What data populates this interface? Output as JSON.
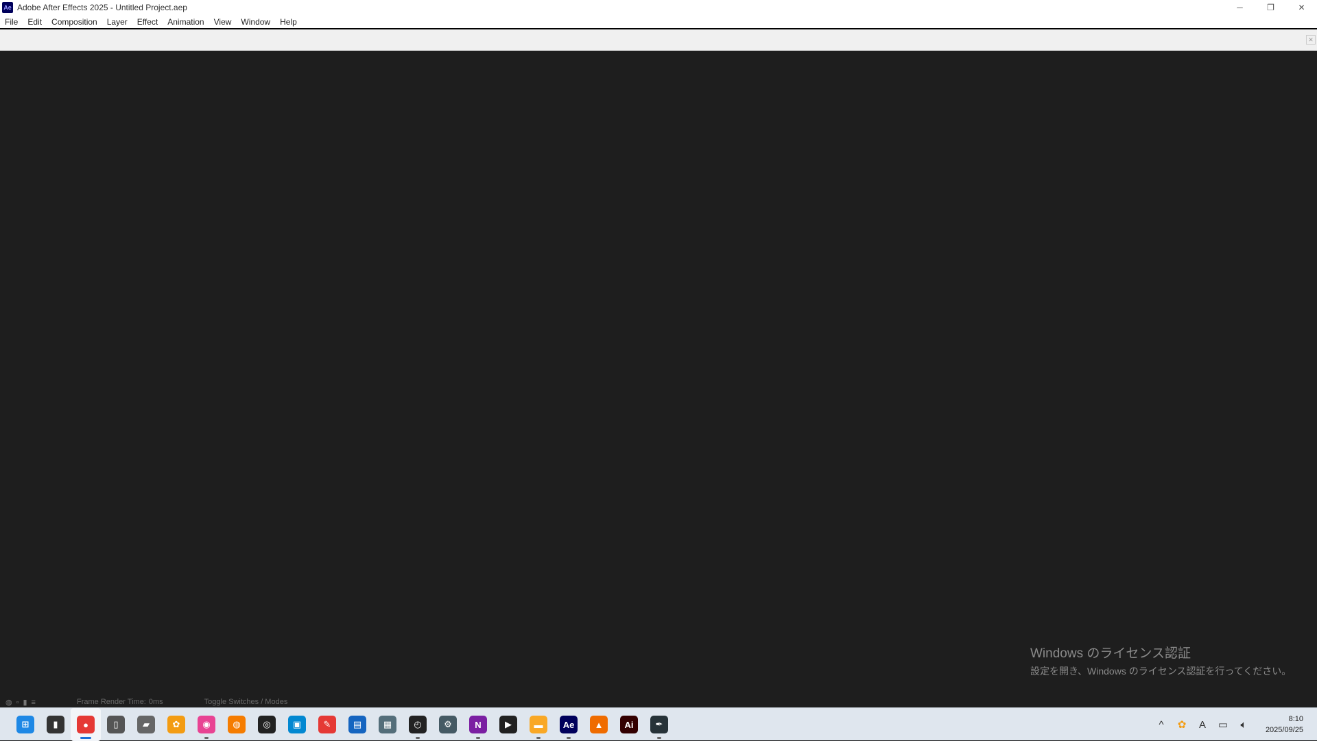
{
  "window": {
    "app_icon_text": "Ae",
    "title": "Adobe After Effects 2025 - Untitled Project.aep",
    "minimize_icon": "minimize-icon",
    "restore_icon": "restore-icon",
    "close_icon": "close-icon"
  },
  "menu": {
    "items": [
      "File",
      "Edit",
      "Composition",
      "Layer",
      "Effect",
      "Animation",
      "View",
      "Window",
      "Help"
    ]
  },
  "status": {
    "frame_render": "Frame Render Time:",
    "frame_render_value": "0ms",
    "toggle": "Toggle Switches / Modes"
  },
  "watermark": {
    "title": "Windows のライセンス認証",
    "subtitle": "設定を開き、Windows のライセンス認証を行ってください。"
  },
  "taskbar": {
    "apps": [
      {
        "name": "start-icon",
        "glyph": "⊞",
        "color": "#1e88e5"
      },
      {
        "name": "task-view-icon",
        "glyph": "▮",
        "color": "#333333"
      },
      {
        "name": "chrome-icon",
        "glyph": "●",
        "color": "#e53935"
      },
      {
        "name": "notebook-icon",
        "glyph": "▯",
        "color": "#555555"
      },
      {
        "name": "book-icon",
        "glyph": "▰",
        "color": "#666666"
      },
      {
        "name": "paw-icon",
        "glyph": "✿",
        "color": "#f39c12"
      },
      {
        "name": "color-app-icon",
        "glyph": "◉",
        "color": "#e84393"
      },
      {
        "name": "blender-icon",
        "glyph": "◍",
        "color": "#f57c00"
      },
      {
        "name": "davinci-icon",
        "glyph": "◎",
        "color": "#222222"
      },
      {
        "name": "photos-icon",
        "glyph": "▣",
        "color": "#0288d1"
      },
      {
        "name": "brush-app-icon",
        "glyph": "✎",
        "color": "#e53935"
      },
      {
        "name": "image-viewer-icon",
        "glyph": "▤",
        "color": "#1565c0"
      },
      {
        "name": "calculator-icon",
        "glyph": "▦",
        "color": "#546e7a"
      },
      {
        "name": "clock-app-icon",
        "glyph": "◴",
        "color": "#222222"
      },
      {
        "name": "settings-icon",
        "glyph": "⚙",
        "color": "#455a64"
      },
      {
        "name": "onenote-icon",
        "glyph": "N",
        "color": "#7b1fa2"
      },
      {
        "name": "media-player-icon",
        "glyph": "▶",
        "color": "#212121"
      },
      {
        "name": "file-explorer-icon",
        "glyph": "▬",
        "color": "#f9a825"
      },
      {
        "name": "after-effects-icon",
        "glyph": "Ae",
        "color": "#00005b"
      },
      {
        "name": "vlc-icon",
        "glyph": "▲",
        "color": "#ef6c00"
      },
      {
        "name": "illustrator-icon",
        "glyph": "Ai",
        "color": "#330000"
      },
      {
        "name": "inkscape-icon",
        "glyph": "✒",
        "color": "#263238"
      }
    ],
    "tray_chevron": "^",
    "tray_ime": "A",
    "time": "8:10",
    "date": "2025/09/25"
  }
}
